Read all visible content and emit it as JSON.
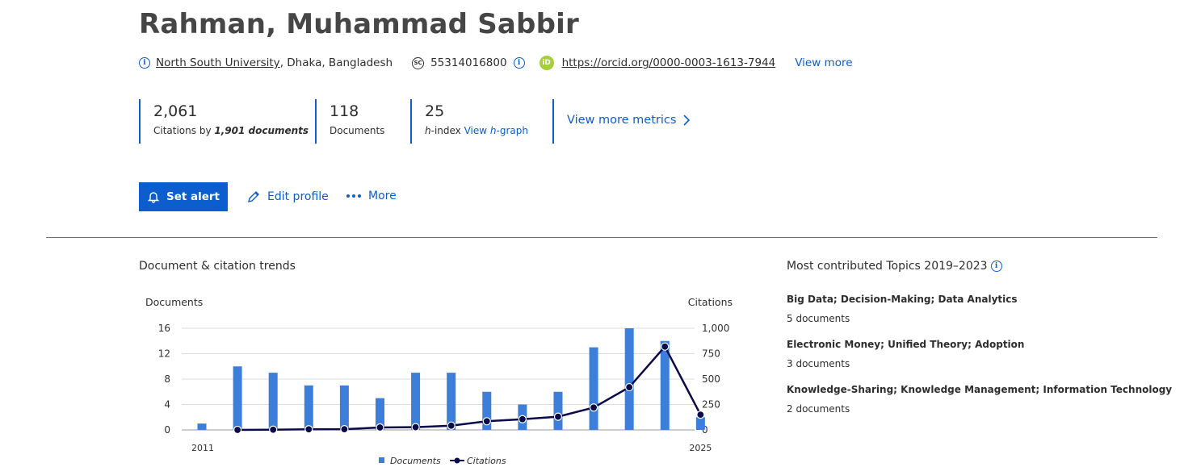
{
  "profile": {
    "name": "Rahman, Muhammad Sabbir",
    "affiliation": "North South University",
    "location": ", Dhaka, Bangladesh",
    "scopus_id": "55314016800",
    "orcid_url": "https://orcid.org/0000-0003-1613-7944",
    "view_more": "View more"
  },
  "metrics": [
    {
      "value": "2,061",
      "label_prefix": "Citations by ",
      "label_bold": "1,901 documents"
    },
    {
      "value": "118",
      "label": "Documents"
    },
    {
      "value": "25",
      "label_italic": "h",
      "label_rest": "-index ",
      "link_prefix": "View ",
      "link_italic": "h",
      "link_rest": "-graph"
    }
  ],
  "view_more_metrics": "View more metrics",
  "actions": {
    "set_alert": "Set alert",
    "edit_profile": "Edit profile",
    "more": "More"
  },
  "trends": {
    "title": "Document & citation trends"
  },
  "chart_data": {
    "type": "bar",
    "x": [
      2011,
      2012,
      2013,
      2014,
      2015,
      2016,
      2017,
      2018,
      2019,
      2020,
      2021,
      2022,
      2023,
      2024,
      2025
    ],
    "x_tick_labels": [
      "2011",
      "2025"
    ],
    "series": [
      {
        "name": "Documents",
        "type": "bar",
        "axis": "left",
        "color": "#3b7fdb",
        "values": [
          1,
          10,
          9,
          7,
          7,
          5,
          9,
          9,
          6,
          4,
          6,
          13,
          16,
          14,
          2
        ]
      },
      {
        "name": "Citations",
        "type": "line",
        "axis": "right",
        "color": "#0a0a4a",
        "values": [
          null,
          0,
          2,
          6,
          7,
          24,
          27,
          42,
          85,
          105,
          130,
          220,
          420,
          820,
          150
        ]
      }
    ],
    "ylabel_left": "Documents",
    "ylabel_right": "Citations",
    "ylim_left": [
      0,
      16
    ],
    "yticks_left": [
      "0",
      "4",
      "8",
      "12",
      "16"
    ],
    "ylim_right": [
      0,
      1000
    ],
    "yticks_right": [
      "0",
      "250",
      "500",
      "750",
      "1,000"
    ],
    "grid": true,
    "legend_position": "bottom"
  },
  "topics": {
    "title": "Most contributed Topics 2019–2023",
    "items": [
      {
        "name": "Big Data; Decision-Making; Data Analytics",
        "docs": "5 documents"
      },
      {
        "name": "Electronic Money; Unified Theory; Adoption",
        "docs": "3 documents"
      },
      {
        "name": "Knowledge-Sharing; Knowledge Management; Information Technology",
        "docs": "2 documents"
      }
    ]
  }
}
